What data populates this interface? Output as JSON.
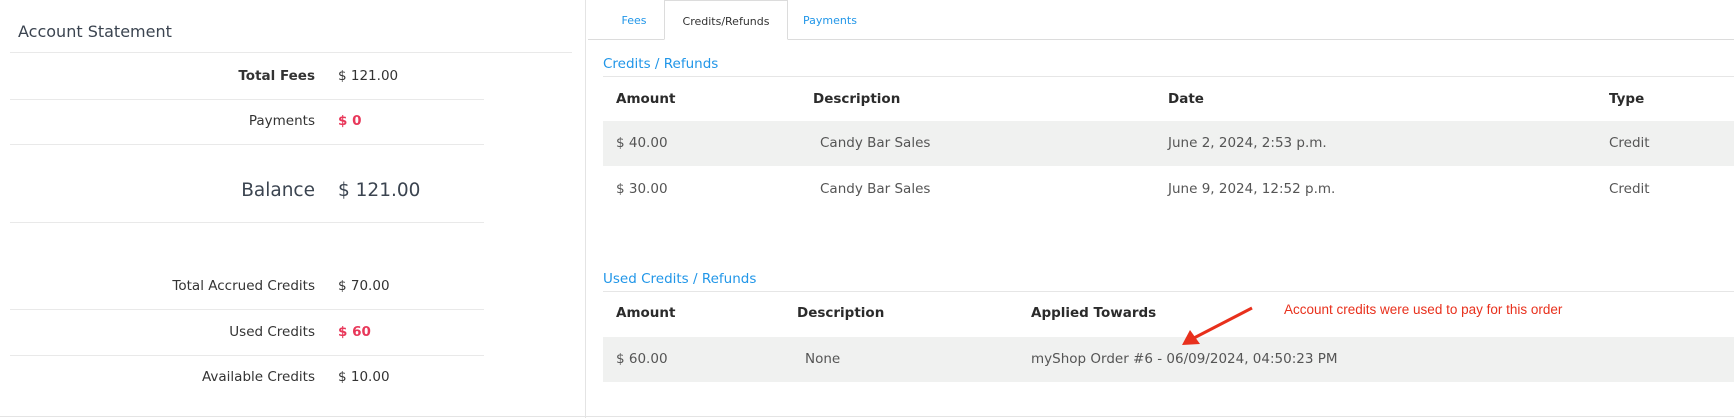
{
  "account_statement": {
    "title": "Account Statement",
    "total_fees_label": "Total Fees",
    "total_fees_value": "$ 121.00",
    "payments_label": "Payments",
    "payments_value": "$ 0",
    "balance_label": "Balance",
    "balance_value": "$ 121.00",
    "total_accrued_credits_label": "Total Accrued Credits",
    "total_accrued_credits_value": "$ 70.00",
    "used_credits_label": "Used Credits",
    "used_credits_value": "$ 60",
    "available_credits_label": "Available Credits",
    "available_credits_value": "$ 10.00"
  },
  "tabs": [
    {
      "label": "Fees",
      "active": false
    },
    {
      "label": "Credits/Refunds",
      "active": true
    },
    {
      "label": "Payments",
      "active": false
    }
  ],
  "credits": {
    "title": "Credits / Refunds",
    "headers": [
      "Amount",
      "Description",
      "Date",
      "Type"
    ],
    "rows": [
      [
        "$ 40.00",
        "Candy Bar Sales",
        "June 2, 2024, 2:53 p.m.",
        "Credit"
      ],
      [
        "$ 30.00",
        "Candy Bar Sales",
        "June 9, 2024, 12:52 p.m.",
        "Credit"
      ]
    ]
  },
  "used_credits": {
    "title": "Used Credits / Refunds",
    "headers": [
      "Amount",
      "Description",
      "Applied Towards"
    ],
    "rows": [
      [
        "$ 60.00",
        "None",
        "myShop Order #6 - 06/09/2024, 04:50:23 PM"
      ]
    ]
  },
  "annotation": {
    "text": "Account credits were used  to pay for this order",
    "color": "#e8301c"
  },
  "colors": {
    "link": "#2196e8",
    "negative": "#e8385a",
    "row_shade": "#f0f1f0"
  }
}
